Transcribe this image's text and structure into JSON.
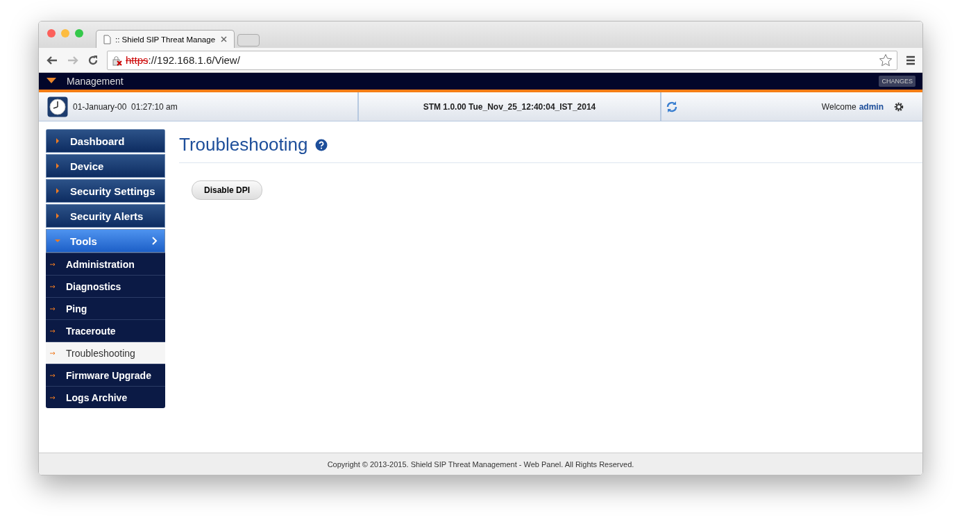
{
  "browser": {
    "tab_title": ":: Shield SIP Threat Manage",
    "url_scheme": "https",
    "url_rest": "://192.168.1.6/View/"
  },
  "header": {
    "brand": "Management",
    "changes_button": "CHANGES"
  },
  "info_bar": {
    "date": "01-January-00",
    "time": "01:27:10 am",
    "version": "STM 1.0.00 Tue_Nov_25_12:40:04_IST_2014",
    "welcome": "Welcome",
    "user": "admin"
  },
  "sidebar": {
    "items": [
      {
        "label": "Dashboard",
        "selected": false,
        "expanded": false
      },
      {
        "label": "Device",
        "selected": false,
        "expanded": false
      },
      {
        "label": "Security Settings",
        "selected": false,
        "expanded": false
      },
      {
        "label": "Security Alerts",
        "selected": false,
        "expanded": false
      },
      {
        "label": "Tools",
        "selected": true,
        "expanded": true,
        "children": [
          {
            "label": "Administration",
            "selected": false
          },
          {
            "label": "Diagnostics",
            "selected": false
          },
          {
            "label": "Ping",
            "selected": false
          },
          {
            "label": "Traceroute",
            "selected": false
          },
          {
            "label": "Troubleshooting",
            "selected": true
          },
          {
            "label": "Firmware Upgrade",
            "selected": false
          },
          {
            "label": "Logs Archive",
            "selected": false
          }
        ]
      }
    ]
  },
  "main": {
    "title": "Troubleshooting",
    "buttons": [
      "Disable DPI"
    ]
  },
  "footer": "Copyright © 2013-2015. Shield SIP Threat Management - Web Panel. All Rights Reserved."
}
